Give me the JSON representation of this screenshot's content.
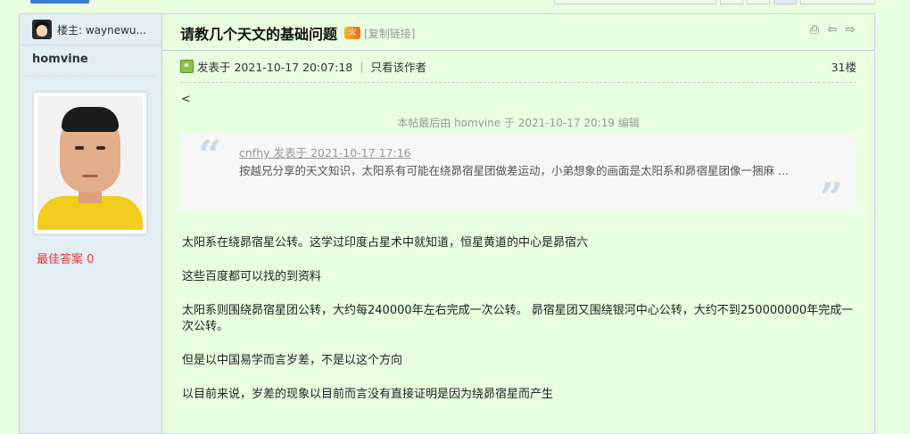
{
  "thread": {
    "owner_label": "楼主: waynewu...",
    "title": "请教几个天文的基础问题",
    "hot_badge": "火",
    "copy_link": "[复制链接]"
  },
  "post": {
    "author": "homvine",
    "best_answer": "最佳答案  0",
    "posted_at": "发表于 2021-10-17 20:07:18",
    "only_author": "只看该作者",
    "floor": "31楼",
    "lt_char": "<",
    "edit_note": "本帖最后由 homvine 于 2021-10-17 20:19 编辑",
    "quote": {
      "by": "cnfhy 发表于 2021-10-17 17:16",
      "text": "按越兄分享的天文知识，太阳系有可能在绕昴宿星团做差运动，小弟想象的画面是太阳系和昴宿星团像一捆麻 ..."
    },
    "paragraphs": [
      "太阳系在绕昴宿星公转。这学过印度占星术中就知道，恒星黄道的中心是昴宿六",
      "这些百度都可以找的到资料",
      "太阳系则围绕昴宿星团公转，大约每240000年左右完成一次公转。 昴宿星团又围绕银河中心公转，大约不到250000000年完成一次公转。",
      "但是以中国易学而言岁差，不是以这个方向",
      "以目前来说，岁差的现象以目前而言没有直接证明是因为绕昴宿星而产生"
    ]
  },
  "icons": {
    "print": "print-icon",
    "prev": "prev-thread-icon",
    "next": "next-thread-icon"
  }
}
